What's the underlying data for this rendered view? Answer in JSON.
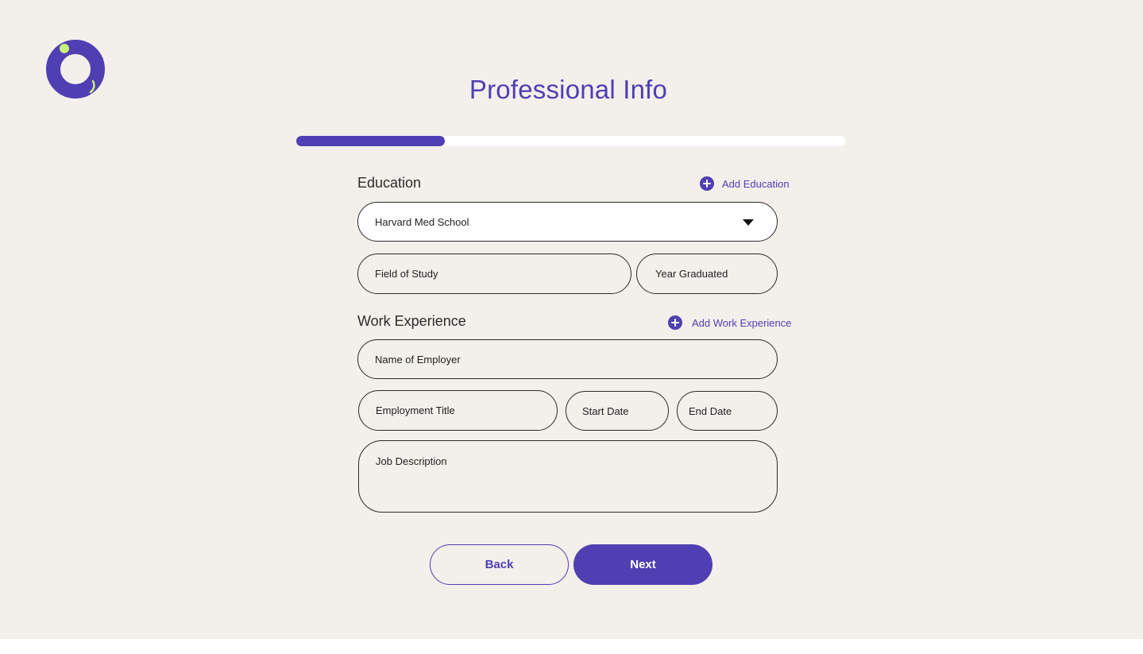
{
  "brand": {
    "logo_icon": "ring-logo-icon",
    "primary": "#4f3fb3",
    "accent": "#c9f07a"
  },
  "header": {
    "title": "Professional Info"
  },
  "progress": {
    "value": 0.27
  },
  "education": {
    "title": "Education",
    "add_label": "Add Education",
    "add_icon": "plus-circle-icon",
    "school_select": {
      "value": "Harvard Med School",
      "icon": "caret-down-icon"
    },
    "field_of_study": {
      "placeholder": "Field of Study"
    },
    "year_graduated": {
      "placeholder": "Year Graduated"
    }
  },
  "work": {
    "title": "Work Experience",
    "add_label": "Add Work Experience",
    "add_icon": "plus-circle-icon",
    "employer": {
      "placeholder": "Name of Employer"
    },
    "employment_title": {
      "placeholder": "Employment Title"
    },
    "start_date": {
      "placeholder": "Start Date"
    },
    "end_date": {
      "placeholder": "End Date"
    },
    "job_description": {
      "placeholder": "Job Description"
    }
  },
  "actions": {
    "back_label": "Back",
    "next_label": "Next"
  }
}
